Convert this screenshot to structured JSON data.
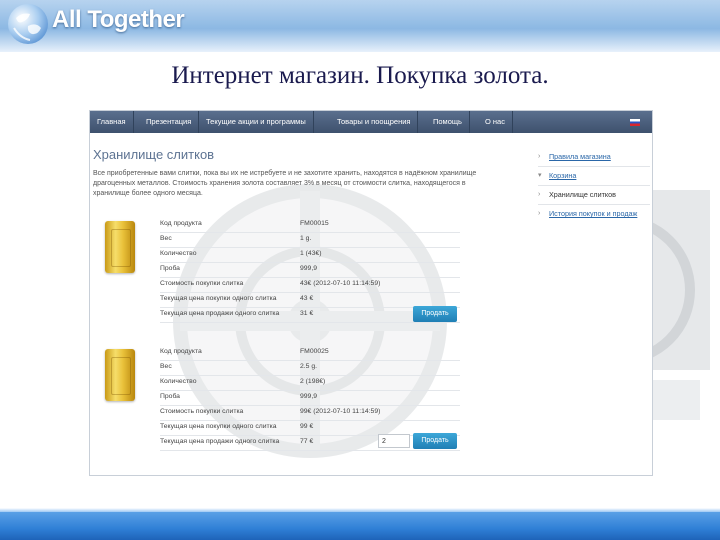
{
  "slide": {
    "logo_text": "All Together",
    "title": "Интернет магазин. Покупка золота."
  },
  "nav": [
    {
      "label": "Главная"
    },
    {
      "label": "Презентация"
    },
    {
      "label": "Текущие акции и программы"
    },
    {
      "label": "Товары и поощрения"
    },
    {
      "label": "Помощь"
    },
    {
      "label": "О нас"
    }
  ],
  "page": {
    "heading": "Хранилище слитков",
    "intro": "Все приобретенные вами слитки, пока вы их не истребуете и не захотите хранить, находятся в надёжном хранилище драгоценных металлов. Стоимость хранения золота составляет 3% в месяц от стоимости слитка, находящегося в хранилище более одного месяца."
  },
  "labels": {
    "code": "Код продукта",
    "weight": "Вес",
    "quantity": "Количество",
    "purity": "Проба",
    "purchase_cost": "Стоимость покупки слитка",
    "current_buy_price": "Текущая цена покупки одного слитка",
    "current_sell_price": "Текущая цена продажи одного слитка"
  },
  "items": [
    {
      "code": "FM00015",
      "weight": "1 g.",
      "quantity": "1 (43€)",
      "purity": "999,9",
      "purchase_cost": "43€ (2012-07-10 11:14:59)",
      "current_buy_price": "43 €",
      "current_sell_price": "31 €",
      "sell_label": "Продать"
    },
    {
      "code": "FM00025",
      "weight": "2.5 g.",
      "quantity": "2 (198€)",
      "purity": "999,9",
      "purchase_cost": "99€ (2012-07-10 11:14:59)",
      "current_buy_price": "99 €",
      "current_sell_price": "77 €",
      "qty_input": "2",
      "sell_label": "Продать"
    }
  ],
  "sidebar": [
    {
      "icon": "arrow-icon",
      "label": "Правила магазина"
    },
    {
      "icon": "cart-icon",
      "label": "Корзина"
    },
    {
      "icon": "arrow-icon",
      "label": "Хранилище слитков"
    },
    {
      "icon": "arrow-icon",
      "label": "История покупок и продаж"
    }
  ],
  "colors": {
    "nav_bg": "#3e516d",
    "button": "#1f7fb5",
    "heading": "#5d7392",
    "footer_band": "#2f7fd6"
  }
}
